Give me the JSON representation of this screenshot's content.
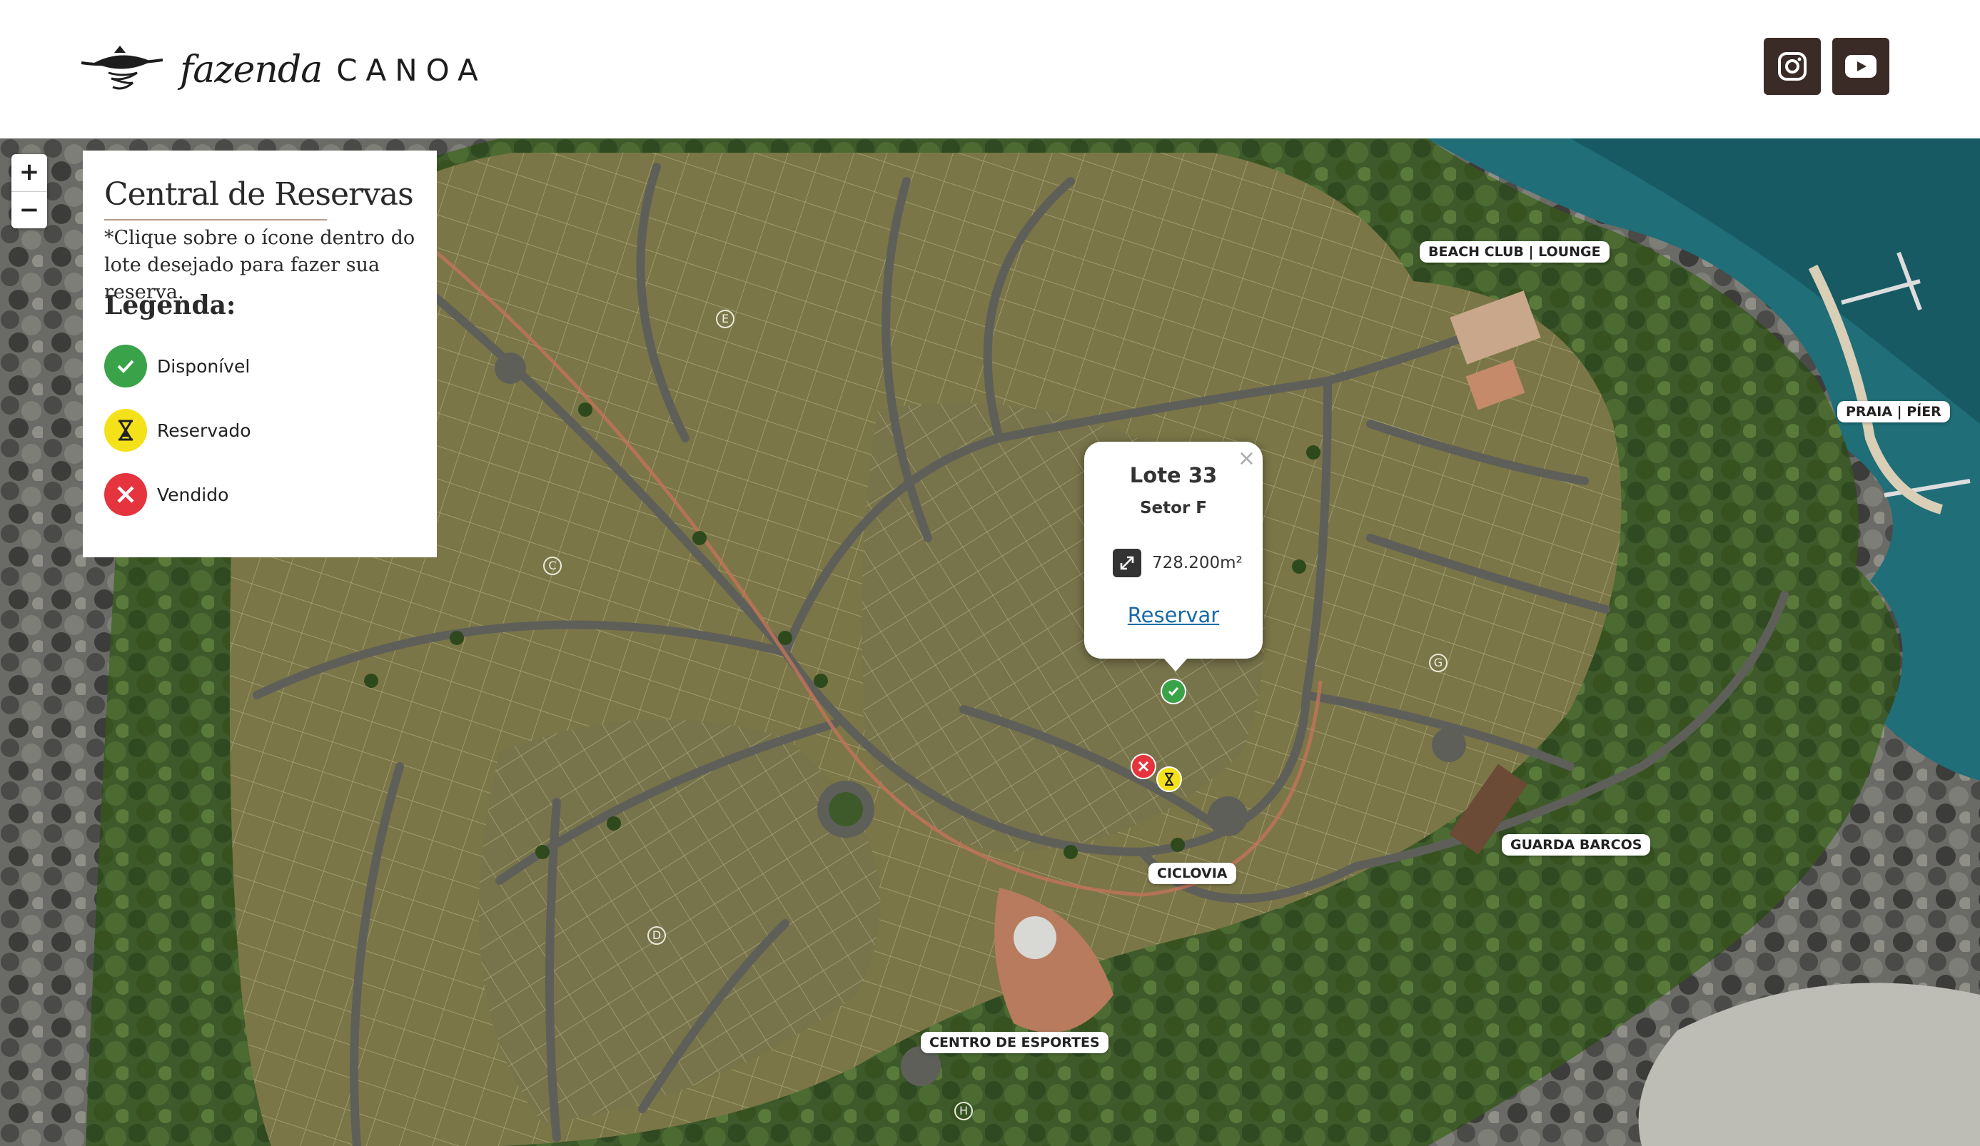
{
  "header": {
    "brand_script": "fazenda",
    "brand_word": "CANOA",
    "social": [
      {
        "icon": "instagram-icon"
      },
      {
        "icon": "youtube-icon"
      }
    ]
  },
  "map": {
    "zoom_in": "+",
    "zoom_out": "−",
    "labels": {
      "beach_club": "BEACH CLUB | LOUNGE",
      "praia_pier": "PRAIA | PÍER",
      "guarda_barcos": "GUARDA BARCOS",
      "ciclovia": "CICLOVIA",
      "centro_esportes": "CENTRO DE ESPORTES"
    },
    "sectors": [
      "E",
      "C",
      "G",
      "D",
      "H"
    ]
  },
  "panel": {
    "title": "Central de Reservas",
    "note": "*Clique sobre o ícone dentro do lote desejado para fazer sua reserva.",
    "legend_title": "Legenda:",
    "legend": [
      {
        "label": "Disponível",
        "color": "#3aa34a",
        "icon": "check-icon"
      },
      {
        "label": "Reservado",
        "color": "#f5e11a",
        "icon": "hourglass-icon"
      },
      {
        "label": "Vendido",
        "color": "#e5343d",
        "icon": "x-icon"
      }
    ]
  },
  "popup": {
    "title": "Lote 33",
    "subtitle": "Setor F",
    "area": "728.200m²",
    "link": "Reservar",
    "close": "×"
  },
  "colors": {
    "header_button": "#3a2b27",
    "available": "#3aa34a",
    "reserved": "#f5e11a",
    "sold": "#e5343d",
    "link": "#1a6aa8"
  }
}
